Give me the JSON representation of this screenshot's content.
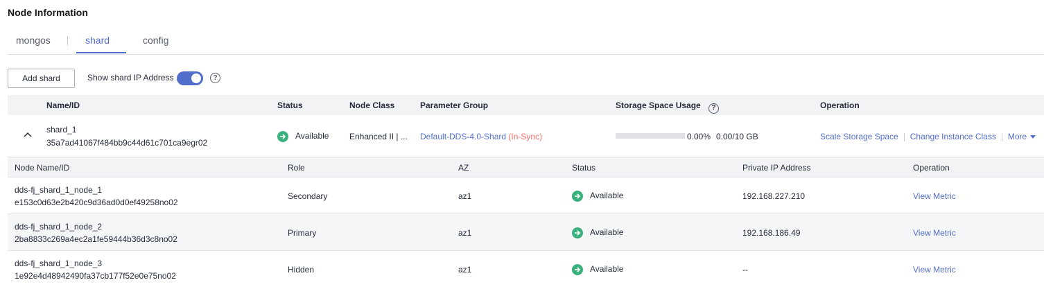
{
  "section": {
    "title": "Node Information"
  },
  "tabs": [
    {
      "label": "mongos",
      "active": false
    },
    {
      "label": "shard",
      "active": true
    },
    {
      "label": "config",
      "active": false
    }
  ],
  "toolbar": {
    "add_shard_label": "Add shard",
    "toggle_label": "Show shard IP Address",
    "toggle_on": true,
    "help_glyph": "?"
  },
  "shard_table": {
    "headers": {
      "name_id": "Name/ID",
      "status": "Status",
      "node_class": "Node Class",
      "parameter_group": "Parameter Group",
      "storage": "Storage Space Usage",
      "operation": "Operation"
    },
    "row": {
      "name": "shard_1",
      "id": "35a7ad41067f484bb9c44d61c701ca9egr02",
      "status": "Available",
      "node_class": "Enhanced II | ...",
      "parameter_group": "Default-DDS-4.0-Shard",
      "parameter_sync": "(In-Sync)",
      "storage_percent": "0.00%",
      "storage_fraction": 0.0,
      "storage_used": "0.00/10 GB",
      "actions": {
        "scale": "Scale Storage Space",
        "change_class": "Change Instance Class",
        "more": "More"
      }
    }
  },
  "node_table": {
    "headers": {
      "name_id": "Node Name/ID",
      "role": "Role",
      "az": "AZ",
      "status": "Status",
      "ip": "Private IP Address",
      "operation": "Operation"
    },
    "rows": [
      {
        "name": "dds-fj_shard_1_node_1",
        "id": "e153c0d63e2b420c9d36ad0d0ef49258no02",
        "role": "Secondary",
        "az": "az1",
        "status": "Available",
        "ip": "192.168.227.210",
        "action": "View Metric"
      },
      {
        "name": "dds-fj_shard_1_node_2",
        "id": "2ba8833c269a4ec2a1fe59444b36d3c8no02",
        "role": "Primary",
        "az": "az1",
        "status": "Available",
        "ip": "192.168.186.49",
        "action": "View Metric"
      },
      {
        "name": "dds-fj_shard_1_node_3",
        "id": "1e92e4d48942490fa37cb177f52e0e75no02",
        "role": "Hidden",
        "az": "az1",
        "status": "Available",
        "ip": "--",
        "action": "View Metric"
      }
    ]
  },
  "colors": {
    "accent": "#526ecc",
    "status_ok": "#3ab07d",
    "sync": "#f66f6a"
  }
}
